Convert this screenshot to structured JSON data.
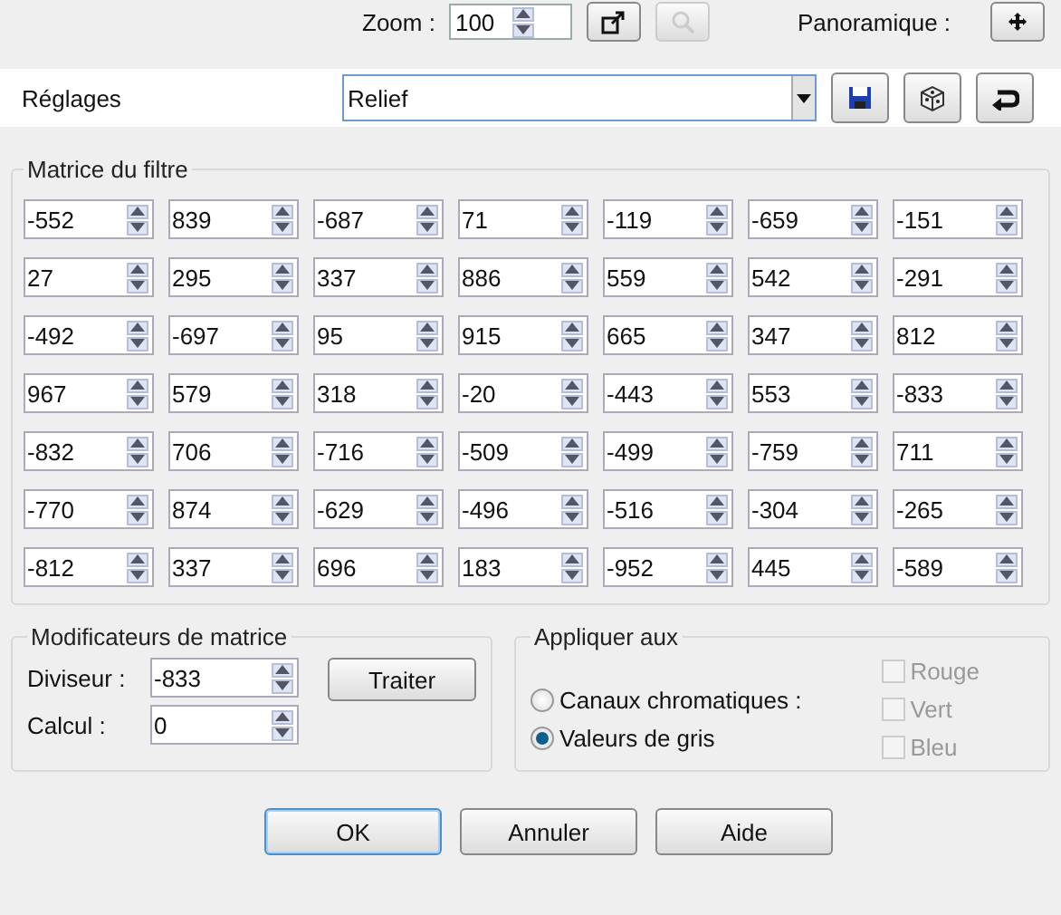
{
  "toolbar": {
    "zoom_label": "Zoom :",
    "zoom_value": "100",
    "pan_label": "Panoramique :"
  },
  "settings": {
    "label": "Réglages",
    "preset": "Relief"
  },
  "matrix": {
    "title": "Matrice du filtre",
    "rows": [
      [
        "-552",
        "839",
        "-687",
        "71",
        "-119",
        "-659",
        "-151"
      ],
      [
        "27",
        "295",
        "337",
        "886",
        "559",
        "542",
        "-291"
      ],
      [
        "-492",
        "-697",
        "95",
        "915",
        "665",
        "347",
        "812"
      ],
      [
        "967",
        "579",
        "318",
        "-20",
        "-443",
        "553",
        "-833"
      ],
      [
        "-832",
        "706",
        "-716",
        "-509",
        "-499",
        "-759",
        "711"
      ],
      [
        "-770",
        "874",
        "-629",
        "-496",
        "-516",
        "-304",
        "-265"
      ],
      [
        "-812",
        "337",
        "696",
        "183",
        "-952",
        "445",
        "-589"
      ]
    ]
  },
  "modifiers": {
    "title": "Modificateurs de matrice",
    "fields": [
      {
        "label": "Diviseur :",
        "value": "-833"
      },
      {
        "label": "Calcul :",
        "value": "0"
      }
    ],
    "button": "Traiter"
  },
  "apply": {
    "title": "Appliquer aux",
    "radios": [
      {
        "label": "Canaux chromatiques :",
        "selected": false
      },
      {
        "label": "Valeurs de gris",
        "selected": true
      }
    ],
    "channels": [
      {
        "label": "Rouge",
        "checked": false,
        "disabled": true
      },
      {
        "label": "Vert",
        "checked": false,
        "disabled": true
      },
      {
        "label": "Bleu",
        "checked": false,
        "disabled": true
      }
    ]
  },
  "buttons": [
    {
      "label": "OK",
      "default": true
    },
    {
      "label": "Annuler",
      "default": false
    },
    {
      "label": "Aide",
      "default": false
    }
  ]
}
